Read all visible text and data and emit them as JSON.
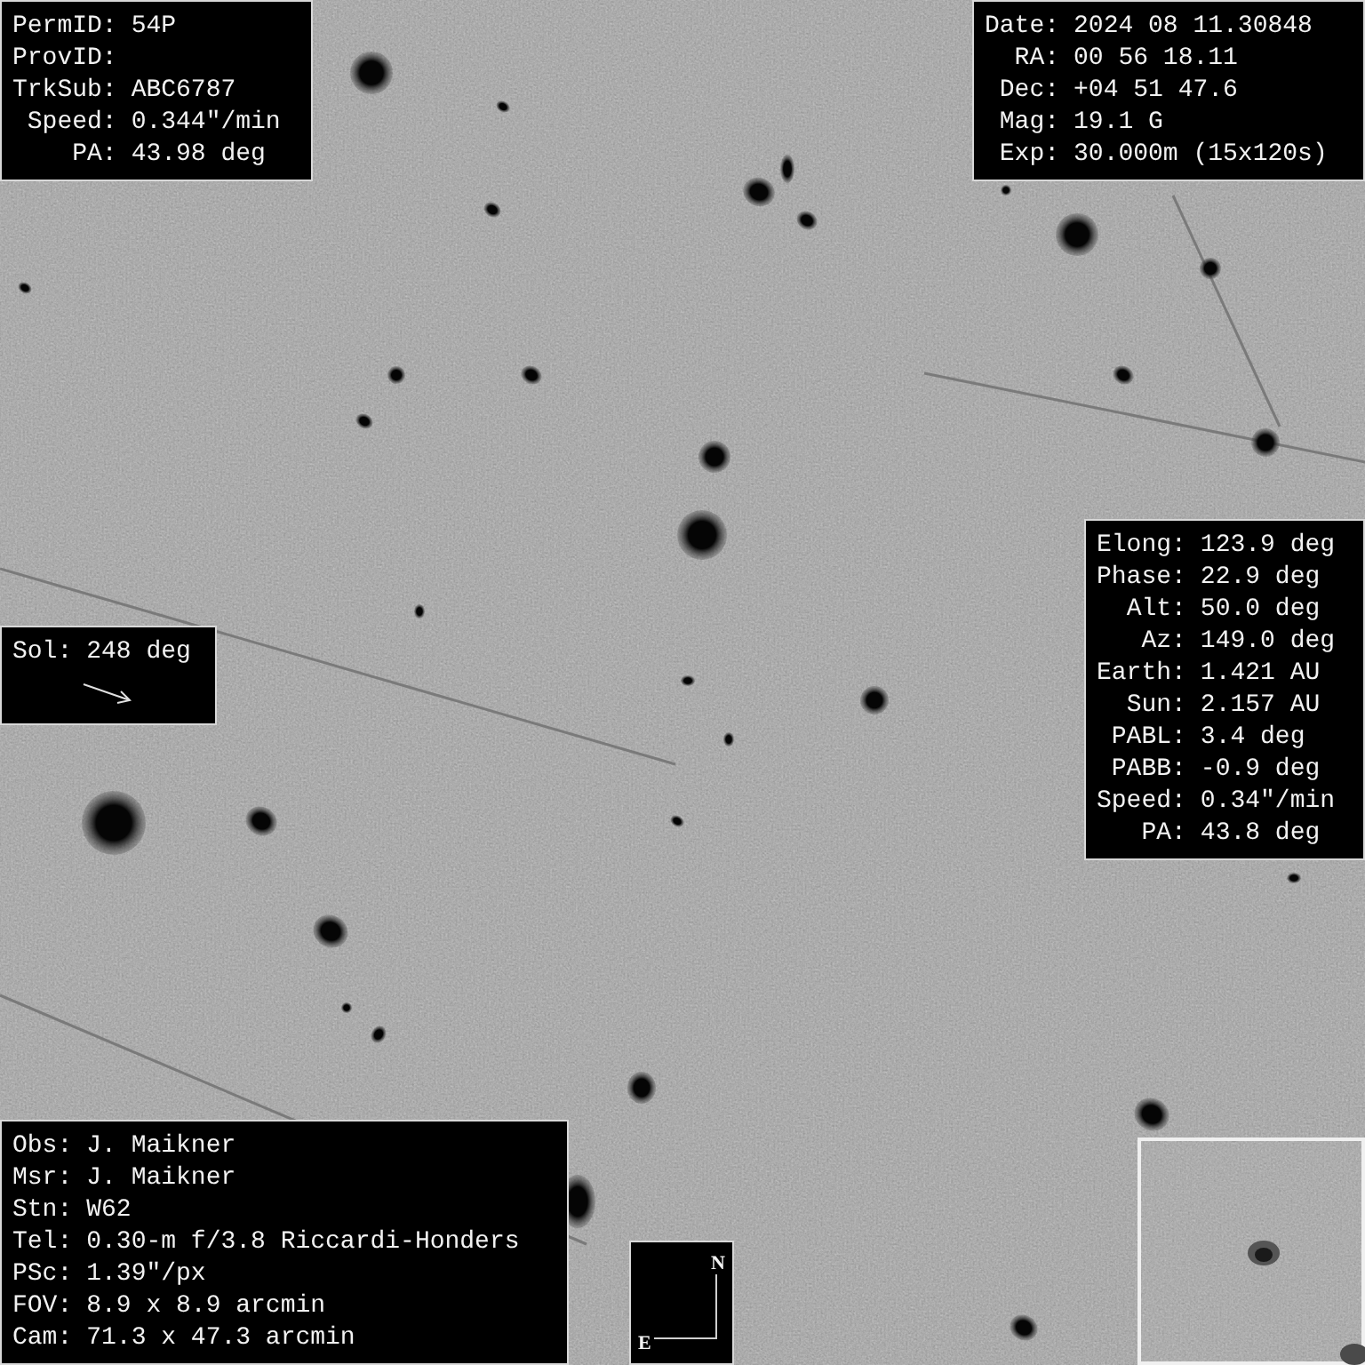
{
  "target_info": {
    "lines": [
      {
        "label": "PermID:",
        "value": "54P"
      },
      {
        "label": "ProvID:"
      },
      {
        "label": "TrkSub:",
        "value": "ABC6787"
      },
      {
        "label": "Speed:",
        "value": "0.344\"/min"
      },
      {
        "label": "PA:",
        "value": "43.98 deg"
      }
    ]
  },
  "observation": {
    "lines": [
      {
        "label": "Date:",
        "value": "2024 08 11.30848"
      },
      {
        "label": "RA:",
        "value": "00 56 18.11"
      },
      {
        "label": "Dec:",
        "value": "+04 51 47.6"
      },
      {
        "label": "Mag:",
        "value": "19.1 G"
      },
      {
        "label": "Exp:",
        "value": "30.000m (15x120s)"
      }
    ]
  },
  "geometry": {
    "lines": [
      {
        "label": "Elong:",
        "value": "123.9 deg"
      },
      {
        "label": "Phase:",
        "value": "22.9 deg"
      },
      {
        "label": "Alt:",
        "value": "50.0 deg"
      },
      {
        "label": "Az:",
        "value": "149.0 deg"
      },
      {
        "label": "Earth:",
        "value": "1.421 AU"
      },
      {
        "label": "Sun:",
        "value": "2.157 AU"
      },
      {
        "label": "PABL:",
        "value": "3.4 deg"
      },
      {
        "label": "PABB:",
        "value": "-0.9 deg"
      },
      {
        "label": "Speed:",
        "value": "0.34\"/min"
      },
      {
        "label": "PA:",
        "value": "43.8 deg"
      }
    ]
  },
  "solar_direction": {
    "label": "Sol:",
    "value": "248 deg"
  },
  "observer_info": {
    "lines": [
      {
        "label": "Obs:",
        "value": "J. Maikner"
      },
      {
        "label": "Msr:",
        "value": "J. Maikner"
      },
      {
        "label": "Stn:",
        "value": "W62"
      },
      {
        "label": "Tel:",
        "value": "0.30-m f/3.8 Riccardi-Honders"
      },
      {
        "label": "PSc:",
        "value": "1.39\"/px"
      },
      {
        "label": "FOV:",
        "value": "8.9 x 8.9 arcmin"
      },
      {
        "label": "Cam:",
        "value": "71.3 x 47.3 arcmin"
      }
    ]
  },
  "compass": {
    "north": "N",
    "east": "E"
  }
}
